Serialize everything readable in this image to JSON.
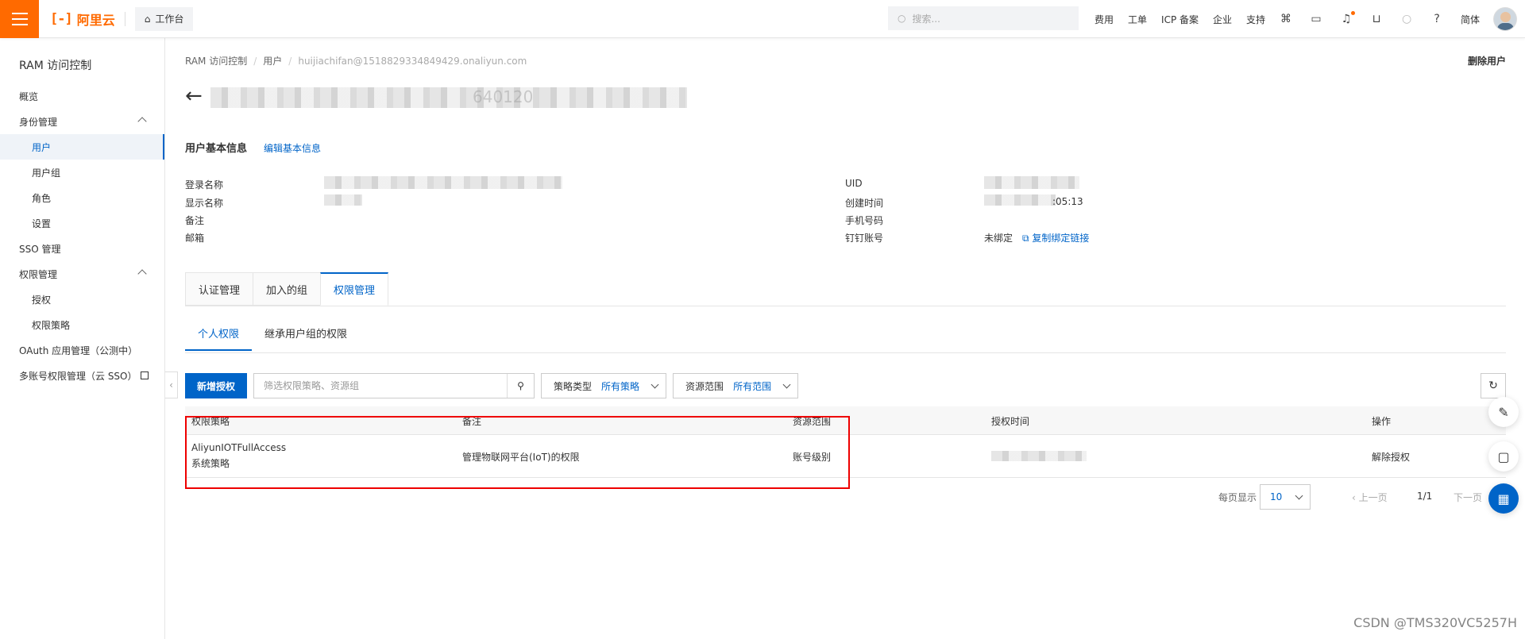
{
  "topbar": {
    "brand": "阿里云",
    "brand_mark": "[-]",
    "workbench": "工作台",
    "search_placeholder": "搜索...",
    "nav": [
      "费用",
      "工单",
      "ICP 备案",
      "企业",
      "支持"
    ],
    "lang": "简体",
    "icons": [
      "code-icon",
      "terminal-icon",
      "bell-icon",
      "cart-icon",
      "bulb-icon",
      "help-icon"
    ],
    "accent": "#ff6a00"
  },
  "sidebar": {
    "title": "RAM 访问控制",
    "items": [
      {
        "label": "概览"
      },
      {
        "label": "身份管理"
      },
      {
        "label": "用户"
      },
      {
        "label": "用户组"
      },
      {
        "label": "角色"
      },
      {
        "label": "设置"
      },
      {
        "label": "SSO 管理"
      },
      {
        "label": "权限管理"
      },
      {
        "label": "授权"
      },
      {
        "label": "权限策略"
      },
      {
        "label": "OAuth 应用管理（公测中）"
      },
      {
        "label": "多账号权限管理（云 SSO）"
      }
    ]
  },
  "breadcrumb": [
    "RAM 访问控制",
    "用户",
    "huijiachifan@1518829334849429.onaliyun.com"
  ],
  "header": {
    "delete_user": "删除用户",
    "title_visible_part": "640120"
  },
  "basic_info": {
    "title": "用户基本信息",
    "edit": "编辑基本信息",
    "left_labels": [
      "登录名称",
      "显示名称",
      "备注",
      "邮箱"
    ],
    "right_labels": [
      "UID",
      "创建时间",
      "手机号码",
      "钉钉账号"
    ],
    "created_time_visible": ":05:13",
    "dingtalk_status": "未绑定",
    "copy_bind_link": "复制绑定链接"
  },
  "tabs": [
    "认证管理",
    "加入的组",
    "权限管理"
  ],
  "active_tab": "权限管理",
  "subtabs": [
    "个人权限",
    "继承用户组的权限"
  ],
  "toolbar": {
    "add_grant": "新增授权",
    "filter_placeholder": "筛选权限策略、资源组",
    "policy_type_label": "策略类型",
    "policy_type_value": "所有策略",
    "scope_label": "资源范围",
    "scope_value": "所有范围"
  },
  "table": {
    "columns": [
      "权限策略",
      "备注",
      "资源范围",
      "授权时间",
      "操作"
    ],
    "rows": [
      {
        "policy": "AliyunIOTFullAccess",
        "policy_type": "系统策略",
        "note": "管理物联网平台(IoT)的权限",
        "scope": "账号级别",
        "action": "解除授权"
      }
    ]
  },
  "pagination": {
    "per_page_label": "每页显示",
    "per_page": "10",
    "prev": "上一页",
    "page": "1/1",
    "next": "下一页"
  },
  "watermark": "CSDN @TMS320VC5257H"
}
